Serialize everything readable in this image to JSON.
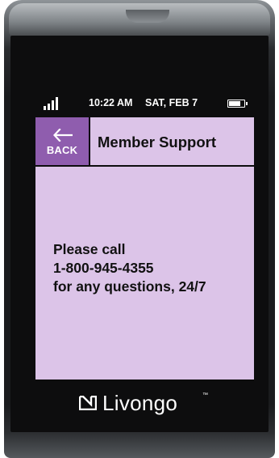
{
  "status_bar": {
    "time": "10:22 AM",
    "date": "SAT, FEB 7",
    "battery_level": 0.85,
    "signal_bars": 4
  },
  "header": {
    "back_label": "BACK",
    "title": "Member Support"
  },
  "message": {
    "line1": "Please call",
    "line2": "1-800-945-4355",
    "line3": "for any questions, 24/7"
  },
  "brand": {
    "name": "Livongo",
    "trademark": "™"
  },
  "icons": {
    "back": "arrow-left-icon",
    "signal": "signal-strength-icon",
    "battery": "battery-icon",
    "logo": "livongo-logo-icon"
  },
  "colors": {
    "screen_background": "#dcc4e8",
    "back_button": "#8f5dae",
    "text": "#111111"
  }
}
